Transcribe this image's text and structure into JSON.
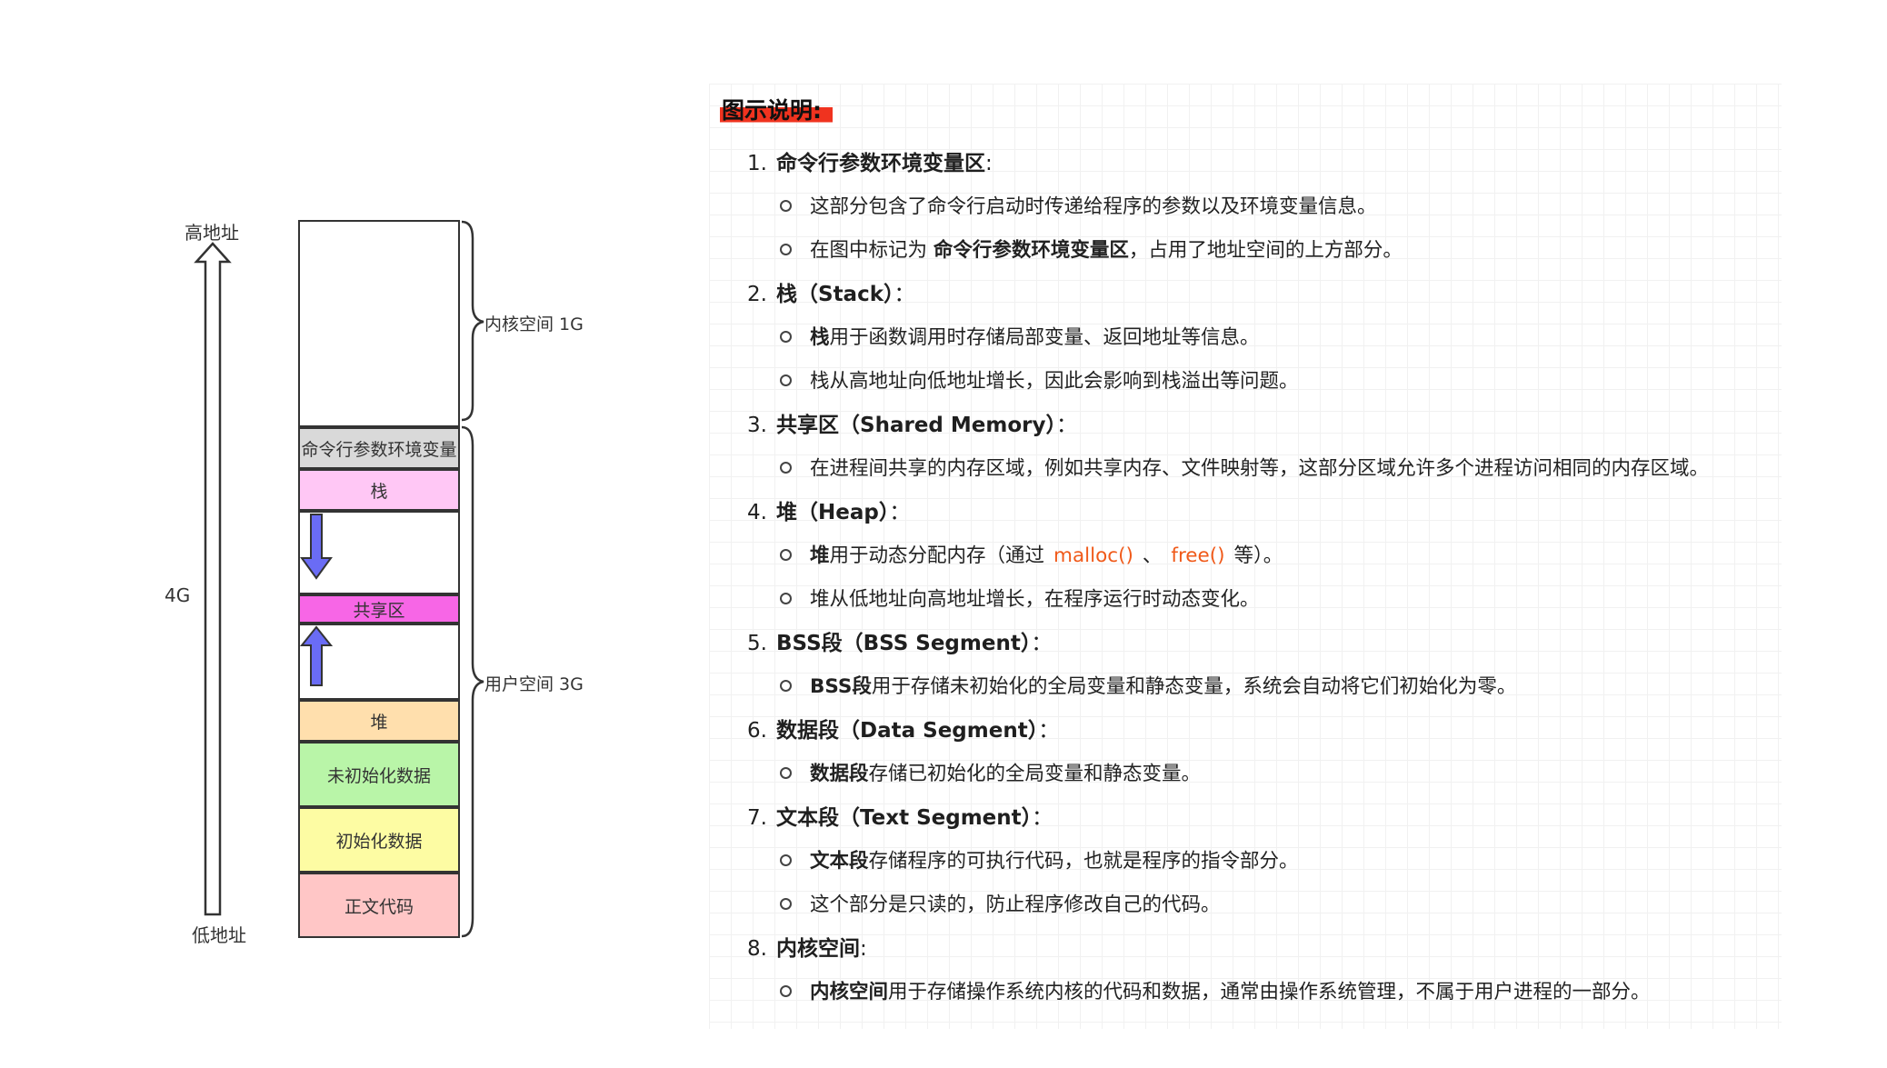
{
  "diagram": {
    "high_address": "高地址",
    "low_address": "低地址",
    "total_size": "4G",
    "kernel_label": "内核空间 1G",
    "user_label": "用户空间 3G",
    "segments": {
      "cmdline_env": "命令行参数环境变量",
      "stack": "栈",
      "shared": "共享区",
      "heap": "堆",
      "bss": "未初始化数据",
      "data": "初始化数据",
      "text": "正文代码"
    },
    "colors": {
      "kernel": "#ffffff",
      "cmdline_env": "#d9d9d9",
      "stack": "#ffc7f5",
      "shared": "#f766e6",
      "heap": "#ffdfad",
      "bss": "#b9f5a8",
      "data": "#fdfca3",
      "text": "#ffc6c6",
      "arrow": "#6a6cf5"
    }
  },
  "panel": {
    "title": "图示说明:",
    "items": [
      {
        "num": "1.",
        "head": "命令行参数环境变量区",
        "tail": ":",
        "bullets": [
          {
            "text": "这部分包含了命令行启动时传递给程序的参数以及环境变量信息。"
          },
          {
            "pre": "在图中标记为 ",
            "bold": "命令行参数环境变量区",
            "text": "，占用了地址空间的上方部分。"
          }
        ]
      },
      {
        "num": "2.",
        "head": "栈（Stack）",
        "tail": "：",
        "bullets": [
          {
            "bold": "栈",
            "text": "用于函数调用时存储局部变量、返回地址等信息。"
          },
          {
            "text": "栈从高地址向低地址增长，因此会影响到栈溢出等问题。"
          }
        ]
      },
      {
        "num": "3.",
        "head": "共享区（Shared Memory）",
        "tail": "：",
        "bullets": [
          {
            "text": "在进程间共享的内存区域，例如共享内存、文件映射等，这部分区域允许多个进程访问相同的内存区域。"
          }
        ]
      },
      {
        "num": "4.",
        "head": "堆（Heap）",
        "tail": "：",
        "bullets": [
          {
            "bold": "堆",
            "text": "用于动态分配内存（通过",
            "code1": "malloc()",
            "sep": "、",
            "code2": "free()",
            "text2": "等）。"
          },
          {
            "text": "堆从低地址向高地址增长，在程序运行时动态变化。"
          }
        ]
      },
      {
        "num": "5.",
        "head": "BSS段（BSS Segment）",
        "tail": "：",
        "bullets": [
          {
            "bold": "BSS段",
            "text": "用于存储未初始化的全局变量和静态变量，系统会自动将它们初始化为零。"
          }
        ]
      },
      {
        "num": "6.",
        "head": "数据段（Data Segment）",
        "tail": "：",
        "bullets": [
          {
            "bold": "数据段",
            "text": "存储已初始化的全局变量和静态变量。"
          }
        ]
      },
      {
        "num": "7.",
        "head": "文本段（Text Segment）",
        "tail": "：",
        "bullets": [
          {
            "bold": "文本段",
            "text": "存储程序的可执行代码，也就是程序的指令部分。"
          },
          {
            "text": "这个部分是只读的，防止程序修改自己的代码。"
          }
        ]
      },
      {
        "num": "8.",
        "head": "内核空间",
        "tail": ":",
        "bullets": [
          {
            "bold": "内核空间",
            "text": "用于存储操作系统内核的代码和数据，通常由操作系统管理，不属于用户进程的一部分。"
          }
        ]
      }
    ]
  }
}
